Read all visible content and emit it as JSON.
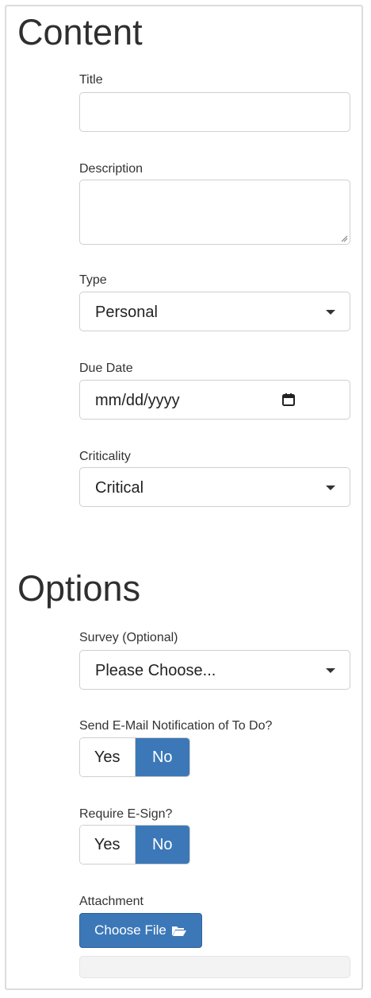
{
  "content_section": {
    "heading": "Content",
    "title_label": "Title",
    "title_value": "",
    "description_label": "Description",
    "description_value": "",
    "type_label": "Type",
    "type_value": "Personal",
    "due_date_label": "Due Date",
    "due_date_placeholder": "mm/dd/yyyy",
    "criticality_label": "Criticality",
    "criticality_value": "Critical"
  },
  "options_section": {
    "heading": "Options",
    "survey_label": "Survey (Optional)",
    "survey_value": "Please Choose...",
    "email_notification_label": "Send E-Mail Notification of To Do?",
    "email_notification_yes": "Yes",
    "email_notification_no": "No",
    "email_notification_selected": "No",
    "esign_label": "Require E-Sign?",
    "esign_yes": "Yes",
    "esign_no": "No",
    "esign_selected": "No",
    "attachment_label": "Attachment",
    "choose_file_label": "Choose File",
    "upload_progress": 0
  },
  "icons": {
    "dropdown": "chevron-down-icon",
    "date_picker": "calendar-icon",
    "file_button": "folder-open-icon",
    "textarea_resize": "resize-grip-icon"
  },
  "colors": {
    "accent": "#3c78b8",
    "border": "#cfcfcf",
    "text": "#333333"
  }
}
